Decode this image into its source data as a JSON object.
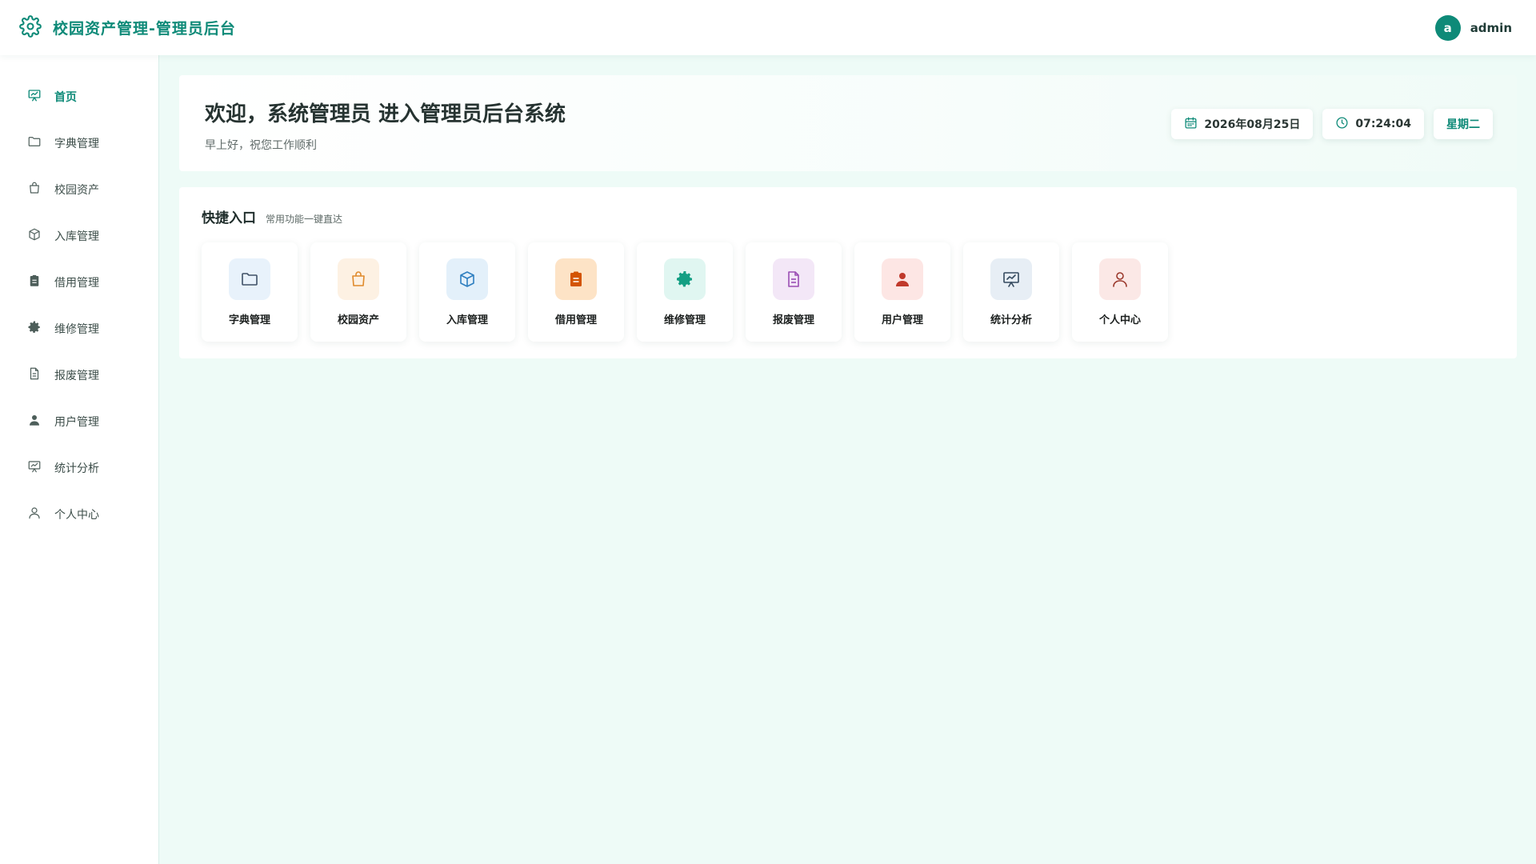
{
  "header": {
    "title": "校园资产管理-管理员后台",
    "user": {
      "avatar_letter": "a",
      "name": "admin"
    },
    "accent": "#0e8a78",
    "logo_icon": "gear-icon"
  },
  "sidebar": {
    "items": [
      {
        "label": "首页",
        "icon": "presentation-icon",
        "active": true
      },
      {
        "label": "字典管理",
        "icon": "folder-icon"
      },
      {
        "label": "校园资产",
        "icon": "shopping-bag-icon"
      },
      {
        "label": "入库管理",
        "icon": "box-icon"
      },
      {
        "label": "借用管理",
        "icon": "clipboard-icon"
      },
      {
        "label": "维修管理",
        "icon": "gear-icon"
      },
      {
        "label": "报废管理",
        "icon": "document-icon"
      },
      {
        "label": "用户管理",
        "icon": "user-filled-icon"
      },
      {
        "label": "统计分析",
        "icon": "presentation-icon"
      },
      {
        "label": "个人中心",
        "icon": "user-outline-icon"
      }
    ]
  },
  "welcome": {
    "title": "欢迎，系统管理员 进入管理员后台系统",
    "subtitle": "早上好，祝您工作顺利",
    "date": "2026年08月25日",
    "time": "07:24:04",
    "weekday": "星期二"
  },
  "quick": {
    "title": "快捷入口",
    "subtitle": "常用功能一键直达",
    "items": [
      {
        "label": "字典管理",
        "icon": "folder-icon",
        "bg": "#e8f2fb",
        "color": "#3f5166"
      },
      {
        "label": "校园资产",
        "icon": "shopping-bag-icon",
        "bg": "#fdf1e3",
        "color": "#e08a2c"
      },
      {
        "label": "入库管理",
        "icon": "box-icon",
        "bg": "#e3f0fa",
        "color": "#2f7fc0"
      },
      {
        "label": "借用管理",
        "icon": "clipboard-icon",
        "bg": "#fde3c6",
        "color": "#d35400"
      },
      {
        "label": "维修管理",
        "icon": "gear-icon",
        "bg": "#e0f6f1",
        "color": "#139f83"
      },
      {
        "label": "报废管理",
        "icon": "document-icon",
        "bg": "#f3e7f7",
        "color": "#9b4fb4"
      },
      {
        "label": "用户管理",
        "icon": "user-filled-icon",
        "bg": "#fde6e4",
        "color": "#c0392b"
      },
      {
        "label": "统计分析",
        "icon": "presentation-icon",
        "bg": "#e7eef5",
        "color": "#34495e"
      },
      {
        "label": "个人中心",
        "icon": "user-outline-icon",
        "bg": "#fbe8e6",
        "color": "#9b3a2e"
      }
    ]
  }
}
